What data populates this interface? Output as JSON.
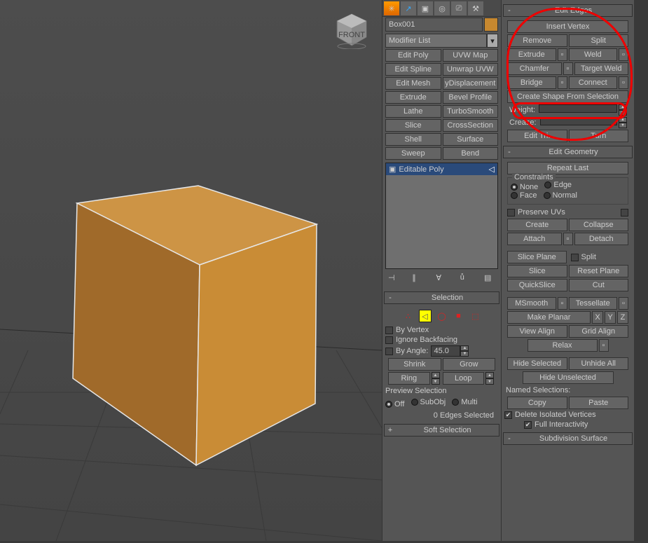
{
  "object_name": "Box001",
  "modifier_list_label": "Modifier List",
  "modifiers": {
    "r0": [
      "Edit Poly",
      "UVW Map"
    ],
    "r1": [
      "Edit Spline",
      "Unwrap UVW"
    ],
    "r2": [
      "Edit Mesh",
      "yDisplacement"
    ],
    "r3": [
      "Extrude",
      "Bevel Profile"
    ],
    "r4": [
      "Lathe",
      "TurboSmooth"
    ],
    "r5": [
      "Slice",
      "CrossSection"
    ],
    "r6": [
      "Shell",
      "Surface"
    ],
    "r7": [
      "Sweep",
      "Bend"
    ]
  },
  "stack_item": "Editable Poly",
  "selection": {
    "title": "Selection",
    "by_vertex": "By Vertex",
    "ignore_backfacing": "Ignore Backfacing",
    "by_angle": "By Angle:",
    "angle_value": "45.0",
    "shrink": "Shrink",
    "grow": "Grow",
    "ring": "Ring",
    "loop": "Loop",
    "preview": "Preview Selection",
    "off": "Off",
    "subobj": "SubObj",
    "multi": "Multi",
    "status": "0 Edges Selected"
  },
  "soft_selection": "Soft Selection",
  "edit_edges": {
    "title": "Edit Edges",
    "insert_vertex": "Insert Vertex",
    "remove": "Remove",
    "split": "Split",
    "extrude": "Extrude",
    "weld": "Weld",
    "chamfer": "Chamfer",
    "target_weld": "Target Weld",
    "bridge": "Bridge",
    "connect": "Connect",
    "create_shape": "Create Shape From Selection",
    "weight": "Weight:",
    "crease": "Crease:",
    "edit_tri": "Edit Tri.",
    "turn": "Turn"
  },
  "edit_geometry": {
    "title": "Edit Geometry",
    "repeat_last": "Repeat Last",
    "constraints": "Constraints",
    "none": "None",
    "edge": "Edge",
    "face": "Face",
    "normal": "Normal",
    "preserve_uvs": "Preserve UVs",
    "create": "Create",
    "collapse": "Collapse",
    "attach": "Attach",
    "detach": "Detach",
    "slice_plane": "Slice Plane",
    "split": "Split",
    "slice": "Slice",
    "reset_plane": "Reset Plane",
    "quickslice": "QuickSlice",
    "cut": "Cut",
    "msmooth": "MSmooth",
    "tessellate": "Tessellate",
    "make_planar": "Make Planar",
    "x": "X",
    "y": "Y",
    "z": "Z",
    "view_align": "View Align",
    "grid_align": "Grid Align",
    "relax": "Relax",
    "hide_selected": "Hide Selected",
    "unhide_all": "Unhide All",
    "hide_unselected": "Hide Unselected",
    "named_selections": "Named Selections:",
    "copy": "Copy",
    "paste": "Paste",
    "delete_isolated": "Delete Isolated Vertices",
    "full_interactivity": "Full Interactivity"
  },
  "subdivision": "Subdivision Surface"
}
